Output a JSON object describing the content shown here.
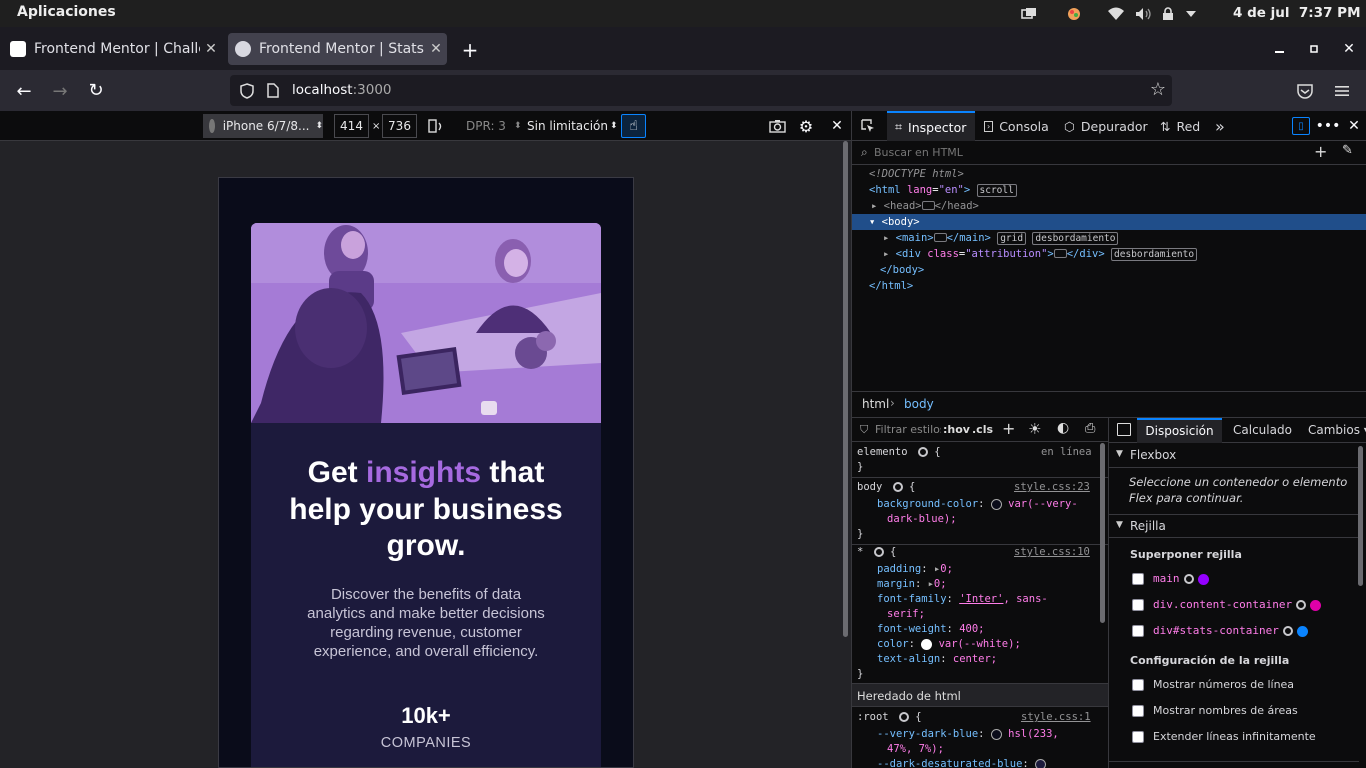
{
  "os": {
    "apps_label": "Aplicaciones",
    "date": "4 de jul",
    "time": "7:37 PM"
  },
  "tabs": [
    {
      "title": "Frontend Mentor | Challenges",
      "active": false
    },
    {
      "title": "Frontend Mentor | Stats preview card component",
      "active": true
    }
  ],
  "url": {
    "host": "localhost",
    "port": ":3000"
  },
  "rdm": {
    "device": "iPhone 6/7/8...",
    "width": "414",
    "times": "×",
    "height": "736",
    "dpr": "DPR: 3",
    "throttle": "Sin limitación"
  },
  "page": {
    "title_pre": "Get ",
    "title_accent": "insights",
    "title_post1": " that",
    "title_line2": "help your business",
    "title_line3": "grow.",
    "description": "Discover the benefits of data analytics and make better decisions regarding revenue, customer experience, and overall efficiency.",
    "stat_value": "10k+",
    "stat_label": "COMPANIES"
  },
  "devtools": {
    "tabs": [
      "Inspector",
      "Consola",
      "Depurador",
      "Red"
    ],
    "search_placeholder": "Buscar en HTML",
    "tree": {
      "doctype": "<!DOCTYPE html>",
      "html_open": "<html",
      "lang_attr": "lang",
      "lang_val": "\"en\"",
      "gt": ">",
      "scroll_badge": "scroll",
      "head_open": "<head>",
      "head_close": "</head>",
      "body_open": "<body>",
      "main_open": "<main>",
      "main_close": "</main>",
      "grid_badge": "grid",
      "overflow_badge": "desbordamiento",
      "div_open": "<div",
      "class_attr": "class",
      "class_val": "\"attribution\"",
      "div_close": "</div>",
      "body_close": "</body>",
      "html_close": "</html>"
    },
    "breadcrumbs": [
      "html",
      "body"
    ],
    "rules_filter": "Filtrar estilos",
    "hov": ":hov",
    "cls": ".cls",
    "rules": {
      "element_sel": "elemento",
      "inline": "en línea",
      "body_sel": "body",
      "body_src": "style.css:23",
      "bg_prop": "background-color",
      "bg_val1": "var(--very-",
      "bg_val2": "dark-blue);",
      "star_sel": "*",
      "star_src": "style.css:10",
      "padding": "padding",
      "padding_val": "0;",
      "margin": "margin",
      "margin_val": "0;",
      "ff": "font-family",
      "ff_val1": "'Inter'",
      "ff_val2": ", sans-",
      "ff_val3": "serif;",
      "fw": "font-weight",
      "fw_val": "400;",
      "color": "color",
      "color_val": "var(--white);",
      "ta": "text-align",
      "ta_val": "center;",
      "inherited": "Heredado de html",
      "root_sel": ":root",
      "root_src": "style.css:1",
      "vdb": "--very-dark-blue",
      "vdb_val1": "hsl(233,",
      "vdb_val2": "47%, 7%);",
      "dds": "--dark-desaturated-blue"
    },
    "layout": {
      "tabs": [
        "Disposición",
        "Calculado",
        "Cambios"
      ],
      "flexbox": "Flexbox",
      "flex_msg": "Seleccione un contenedor o elemento Flex para continuar.",
      "grid": "Rejilla",
      "overlay": "Superponer rejilla",
      "grids": [
        {
          "name": "main",
          "color": "#9400ff"
        },
        {
          "name": "div.content-container",
          "color": "#df00a9"
        },
        {
          "name": "div#stats-container",
          "color": "#0a84ff"
        }
      ],
      "config": "Configuración de la rejilla",
      "options": [
        "Mostrar números de línea",
        "Mostrar nombres de áreas",
        "Extender líneas infinitamente"
      ]
    }
  }
}
